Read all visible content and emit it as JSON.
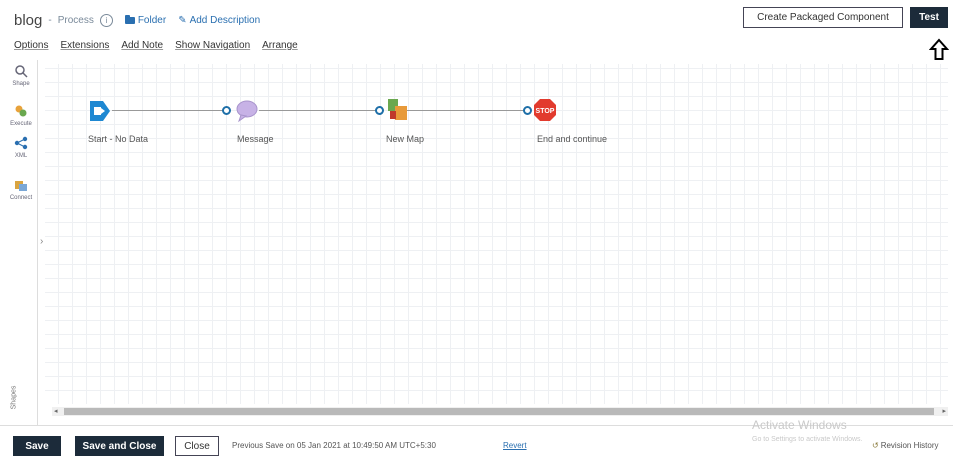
{
  "header": {
    "title": "blog",
    "separator": "-",
    "type": "Process",
    "info_icon": "i",
    "folder_label": "Folder",
    "add_description_label": "Add Description",
    "create_packaged_label": "Create Packaged Component",
    "test_label": "Test"
  },
  "menu": [
    "Options",
    "Extensions",
    "Add Note",
    "Show Navigation",
    "Arrange"
  ],
  "sidebar": {
    "tools": [
      {
        "label": "Shape",
        "icon": "search-icon"
      },
      {
        "label": "Execute",
        "icon": "execute-icon"
      },
      {
        "label": "XML",
        "icon": "connections-icon"
      },
      {
        "label": "Connect",
        "icon": "connect-icon"
      }
    ],
    "shapes_tab": "Shapes"
  },
  "canvas": {
    "shapes": [
      {
        "label": "Start - No Data",
        "icon": "start-shape-icon"
      },
      {
        "label": "Message",
        "icon": "message-shape-icon"
      },
      {
        "label": "New Map",
        "icon": "map-shape-icon"
      },
      {
        "label": "End and continue",
        "icon": "stop-shape-icon",
        "badge": "STOP"
      }
    ]
  },
  "footer": {
    "save_label": "Save",
    "save_close_label": "Save and Close",
    "close_label": "Close",
    "previous_save": "Previous Save on 05 Jan 2021 at 10:49:50 AM UTC+5:30",
    "revert_label": "Revert",
    "watermark_title": "Activate Windows",
    "watermark_sub": "Go to Settings to activate Windows.",
    "version_label": "Revision History"
  },
  "colors": {
    "dark_button": "#1c2b3a",
    "link": "#2a6fb0",
    "port": "#1e6fa8",
    "stop": "#e23b2e",
    "message": "#c7b2e6",
    "start": "#1e88d2"
  }
}
